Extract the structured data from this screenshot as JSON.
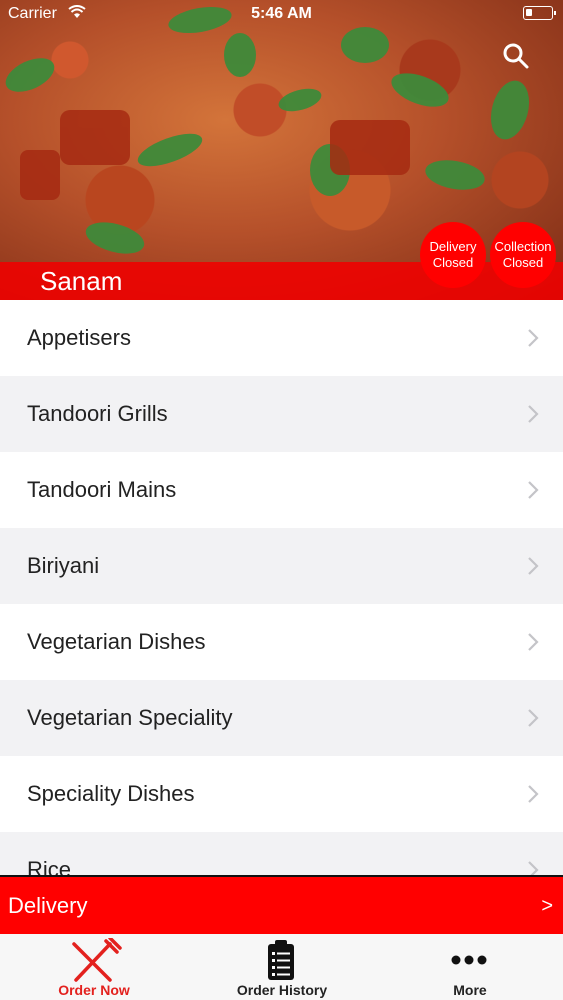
{
  "status_bar": {
    "carrier": "Carrier",
    "time": "5:46 AM"
  },
  "hero": {
    "restaurant_name": "Sanam",
    "badges": {
      "delivery": {
        "line1": "Delivery",
        "line2": "Closed"
      },
      "collection": {
        "line1": "Collection",
        "line2": "Closed"
      }
    }
  },
  "menu": {
    "items": [
      {
        "label": "Appetisers"
      },
      {
        "label": "Tandoori Grills"
      },
      {
        "label": "Tandoori Mains"
      },
      {
        "label": "Biriyani"
      },
      {
        "label": "Vegetarian Dishes"
      },
      {
        "label": "Vegetarian Speciality"
      },
      {
        "label": "Speciality Dishes"
      },
      {
        "label": "Rice"
      }
    ]
  },
  "delivery_bar": {
    "label": "Delivery",
    "arrow": ">"
  },
  "tabs": [
    {
      "label": "Order Now",
      "icon": "fork-knife-icon"
    },
    {
      "label": "Order History",
      "icon": "clipboard-list-icon"
    },
    {
      "label": "More",
      "icon": "more-dots-icon"
    }
  ],
  "colors": {
    "accent": "#ff0000",
    "active_tab": "#e3211e"
  }
}
